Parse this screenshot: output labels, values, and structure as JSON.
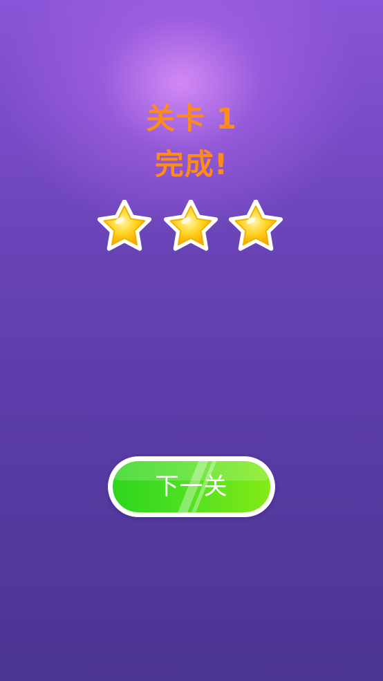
{
  "level_complete": {
    "line1": "关卡 1",
    "line2": "完成!",
    "stars_earned": 3,
    "stars_total": 3
  },
  "next_button": {
    "label": "下一关"
  },
  "colors": {
    "title": "#ff8c1a",
    "star_fill": "#ffd21f",
    "button_green": "#3ddc1f",
    "background_top": "#8a55d8",
    "background_bottom": "#4b3592"
  },
  "icons": [
    "star-icon"
  ]
}
